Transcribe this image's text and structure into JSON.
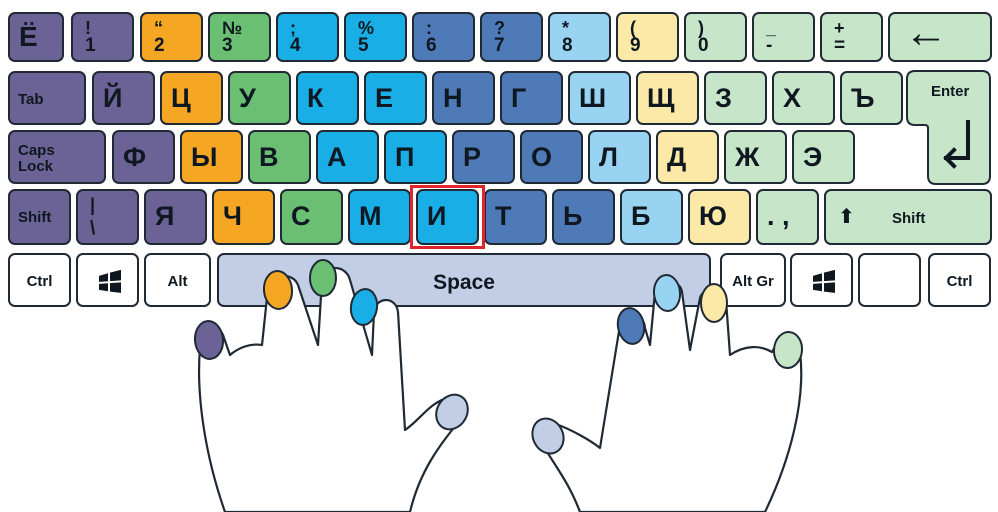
{
  "colors": {
    "purple": "#6b6295",
    "orange": "#f5a623",
    "green": "#6abf73",
    "blue": "#1aaee6",
    "navy": "#4f7ab8",
    "lightblue": "#98d4f2",
    "yellow": "#fce9a8",
    "mint": "#c7e6c9",
    "white": "#ffffff",
    "space": "#c2cde6",
    "highlight": "#e0262a"
  },
  "rows": {
    "number": [
      {
        "main": "Ё",
        "color": "purple"
      },
      {
        "top": "!",
        "main": "1",
        "color": "purple"
      },
      {
        "top": "“",
        "main": "2",
        "color": "orange"
      },
      {
        "top": "№",
        "main": "3",
        "color": "green"
      },
      {
        "top": ";",
        "main": "4",
        "color": "blue"
      },
      {
        "top": "%",
        "main": "5",
        "color": "blue"
      },
      {
        "top": ":",
        "main": "6",
        "color": "navy"
      },
      {
        "top": "?",
        "main": "7",
        "color": "navy"
      },
      {
        "top": "*",
        "main": "8",
        "color": "lightblue"
      },
      {
        "top": "(",
        "main": "9",
        "color": "yellow"
      },
      {
        "top": ")",
        "main": "0",
        "color": "mint"
      },
      {
        "top": "_",
        "main": "-",
        "color": "mint"
      },
      {
        "top": "+",
        "main": "=",
        "color": "mint"
      },
      {
        "label": "←",
        "color": "mint"
      }
    ],
    "top": [
      {
        "label": "Tab",
        "color": "purple"
      },
      {
        "main": "Й",
        "color": "purple"
      },
      {
        "main": "Ц",
        "color": "orange"
      },
      {
        "main": "У",
        "color": "green"
      },
      {
        "main": "К",
        "color": "blue"
      },
      {
        "main": "Е",
        "color": "blue"
      },
      {
        "main": "Н",
        "color": "navy"
      },
      {
        "main": "Г",
        "color": "navy"
      },
      {
        "main": "Ш",
        "color": "lightblue"
      },
      {
        "main": "Щ",
        "color": "yellow"
      },
      {
        "main": "З",
        "color": "mint"
      },
      {
        "main": "Х",
        "color": "mint"
      },
      {
        "main": "Ъ",
        "color": "mint"
      }
    ],
    "home": [
      {
        "label": "Caps\nLock",
        "color": "purple"
      },
      {
        "main": "Ф",
        "color": "purple"
      },
      {
        "main": "Ы",
        "color": "orange"
      },
      {
        "main": "В",
        "color": "green"
      },
      {
        "main": "А",
        "color": "blue"
      },
      {
        "main": "П",
        "color": "blue"
      },
      {
        "main": "Р",
        "color": "navy"
      },
      {
        "main": "О",
        "color": "navy"
      },
      {
        "main": "Л",
        "color": "lightblue"
      },
      {
        "main": "Д",
        "color": "yellow"
      },
      {
        "main": "Ж",
        "color": "mint"
      },
      {
        "main": "Э",
        "color": "mint"
      }
    ],
    "bottom": [
      {
        "label": "Shift",
        "color": "purple"
      },
      {
        "top": "|",
        "main": "\\",
        "color": "purple"
      },
      {
        "main": "Я",
        "color": "purple"
      },
      {
        "main": "Ч",
        "color": "orange"
      },
      {
        "main": "С",
        "color": "green"
      },
      {
        "main": "М",
        "color": "blue"
      },
      {
        "main": "И",
        "color": "blue"
      },
      {
        "main": "Т",
        "color": "navy"
      },
      {
        "main": "Ь",
        "color": "navy"
      },
      {
        "main": "Б",
        "color": "lightblue"
      },
      {
        "main": "Ю",
        "color": "yellow"
      },
      {
        "main": ". ,",
        "color": "mint"
      },
      {
        "label": "Shift",
        "color": "mint"
      }
    ],
    "space": [
      {
        "label": "Ctrl",
        "color": "white"
      },
      {
        "icon": "windows-icon",
        "color": "white"
      },
      {
        "label": "Alt",
        "color": "white"
      },
      {
        "label": "Space",
        "color": "space"
      },
      {
        "label": "Alt Gr",
        "color": "white"
      },
      {
        "icon": "windows-icon",
        "color": "white"
      },
      {
        "label": "",
        "color": "white"
      },
      {
        "label": "Ctrl",
        "color": "white"
      }
    ]
  },
  "enter_label": "Enter",
  "enter_color": "mint",
  "highlighted_key": "И",
  "fingernails": {
    "left": [
      "purple",
      "orange",
      "green",
      "blue",
      "space"
    ],
    "right": [
      "space",
      "navy",
      "lightblue",
      "yellow",
      "mint"
    ]
  }
}
